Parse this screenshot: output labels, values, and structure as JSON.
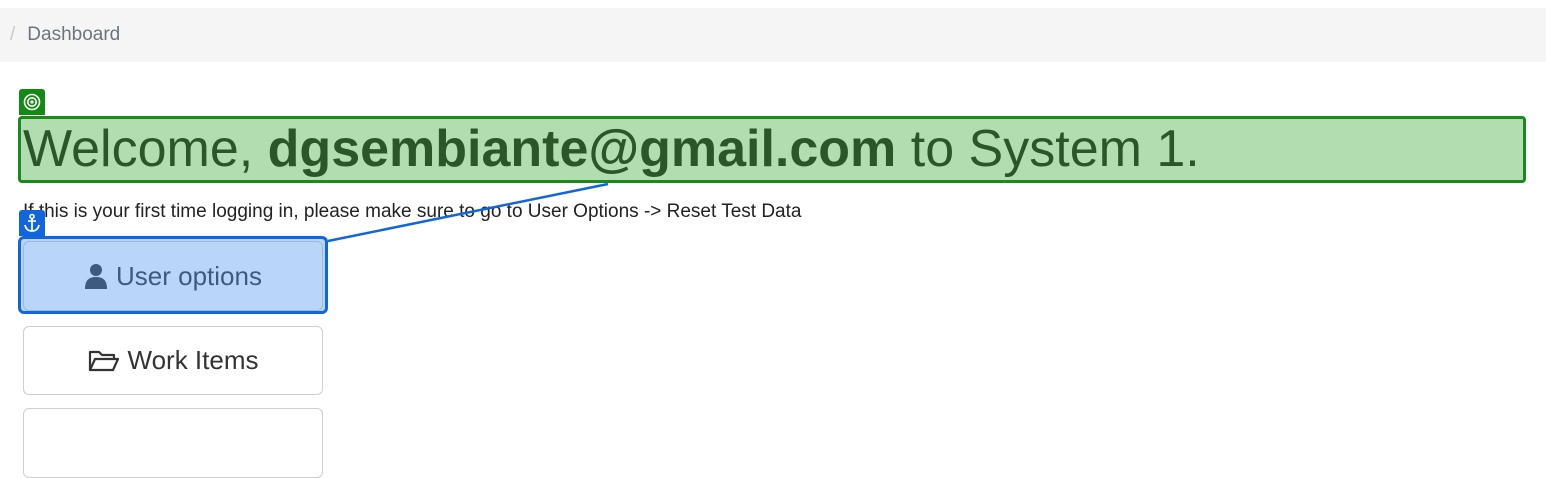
{
  "breadcrumb": {
    "separator": "/",
    "items": [
      {
        "label": "Dashboard"
      }
    ]
  },
  "welcome": {
    "prefix": "Welcome, ",
    "user": "dgsembiante@gmail.com",
    "suffix": " to System 1."
  },
  "hint": "If this is your first time logging in, please make sure to go to User Options -> Reset Test Data",
  "buttons": {
    "user_options": {
      "label": "User options",
      "icon": "user-icon"
    },
    "work_items": {
      "label": "Work Items",
      "icon": "folder-open-icon"
    }
  },
  "overlays": {
    "green": {
      "color": "#1a8a1a",
      "icon": "target-icon"
    },
    "blue": {
      "color": "#1166dd",
      "icon": "anchor-icon"
    }
  }
}
